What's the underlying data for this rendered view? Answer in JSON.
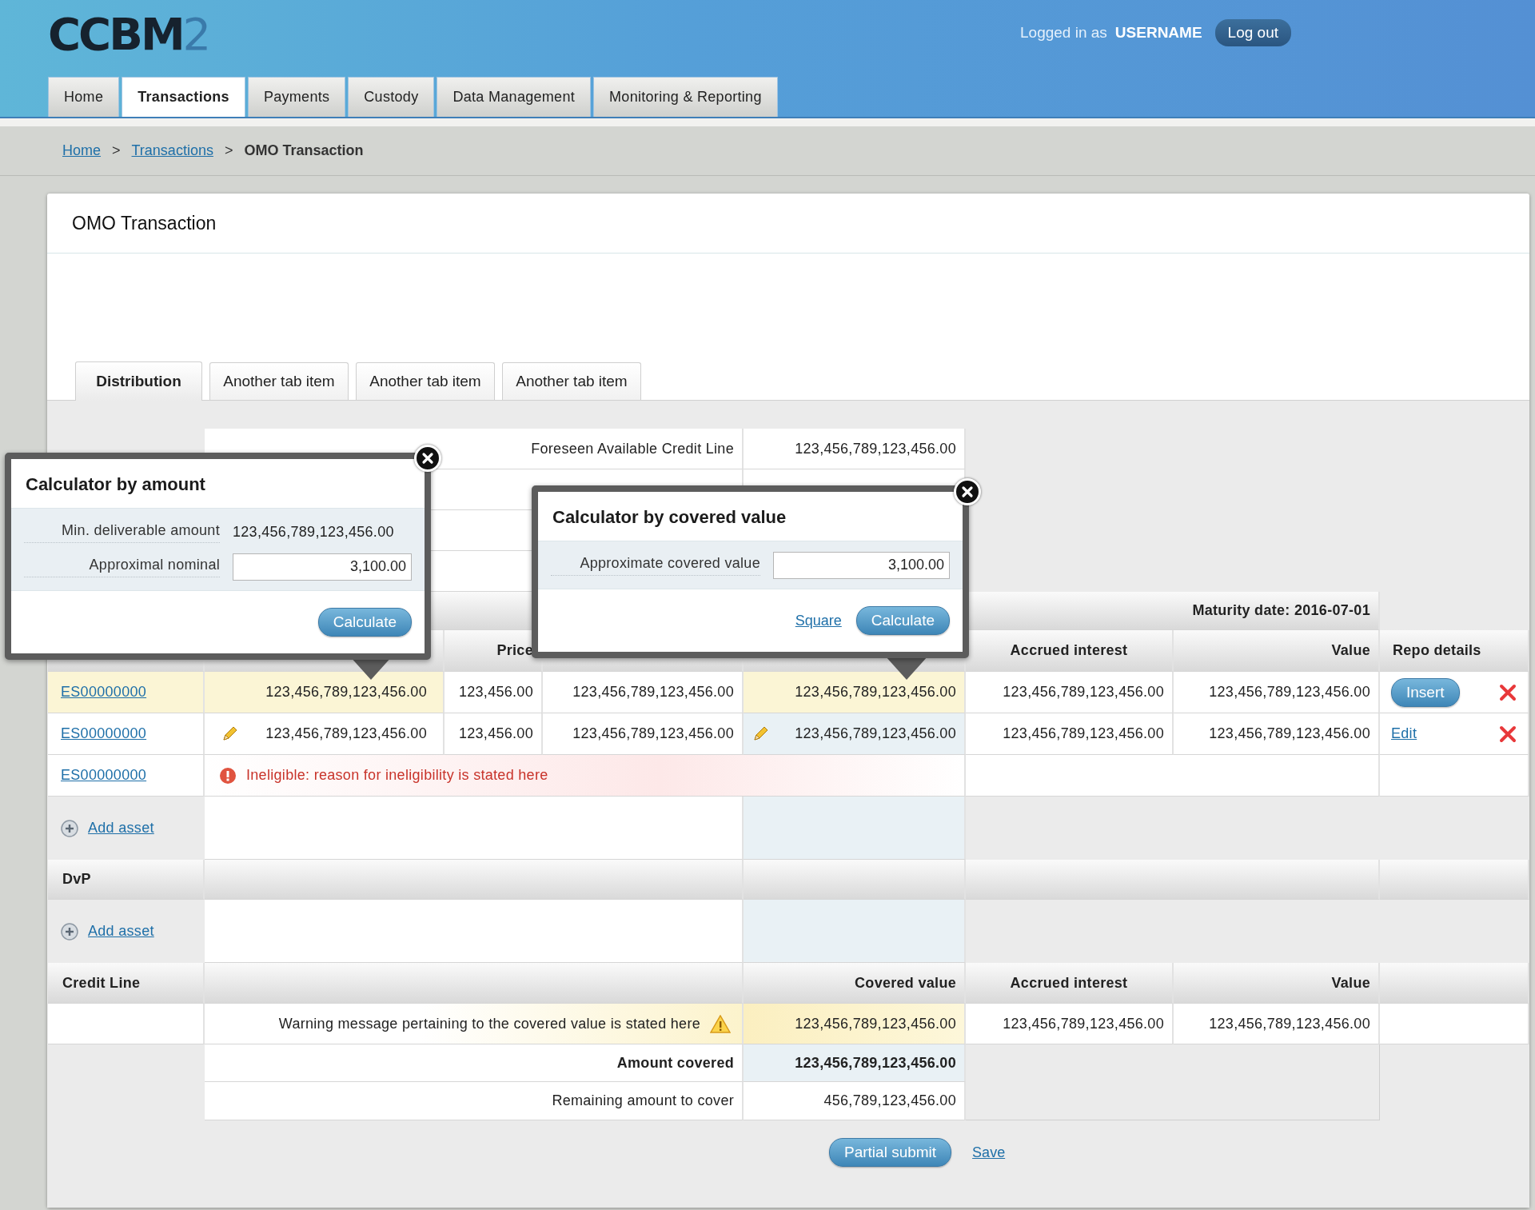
{
  "header": {
    "logo": "CCBM",
    "logo_suffix": "2",
    "logged_in_label": "Logged in as",
    "username": "USERNAME",
    "logout": "Log out"
  },
  "nav": [
    {
      "label": "Home",
      "selected": false
    },
    {
      "label": "Transactions",
      "selected": true
    },
    {
      "label": "Payments",
      "selected": false
    },
    {
      "label": "Custody",
      "selected": false
    },
    {
      "label": "Data Management",
      "selected": false
    },
    {
      "label": "Monitoring & Reporting",
      "selected": false
    }
  ],
  "breadcrumb": [
    {
      "kind": "link",
      "label": "Home"
    },
    {
      "kind": "separator",
      "label": ">"
    },
    {
      "kind": "link",
      "label": "Transactions"
    },
    {
      "kind": "separator",
      "label": ">"
    },
    {
      "kind": "current",
      "label": "OMO Transaction"
    }
  ],
  "page_title": "OMO Transaction",
  "tabs": [
    {
      "label": "Distribution",
      "selected": true
    },
    {
      "label": "Another tab item",
      "selected": false
    },
    {
      "label": "Another tab item",
      "selected": false
    },
    {
      "label": "Another tab item",
      "selected": false
    }
  ],
  "summary": [
    {
      "label": "Foreseen Available Credit Line",
      "value": "123,456,789,123,456.00"
    }
  ],
  "maturity": "Maturity date: 2016-07-01",
  "columns": {
    "price": "Price",
    "accrued_interest": "Accrued interest",
    "value": "Value",
    "repo_details": "Repo details"
  },
  "rows": [
    {
      "kind": "asset",
      "isin": "ES00000000",
      "highlighted": true,
      "editable": false,
      "nominal": "123,456,789,123,456.00",
      "price": "123,456.00",
      "collateral": "123,456,789,123,456.00",
      "covered": "123,456,789,123,456.00",
      "accrued": "123,456,789,123,456.00",
      "value": "123,456,789,123,456.00",
      "action": {
        "kind": "button",
        "label": "Insert"
      },
      "deletable": true
    },
    {
      "kind": "asset",
      "isin": "ES00000000",
      "highlighted": false,
      "editable": true,
      "nominal": "123,456,789,123,456.00",
      "price": "123,456.00",
      "collateral": "123,456,789,123,456.00",
      "covered": "123,456,789,123,456.00",
      "accrued": "123,456,789,123,456.00",
      "value": "123,456,789,123,456.00",
      "action": {
        "kind": "link",
        "label": "Edit"
      },
      "deletable": true
    },
    {
      "kind": "ineligible",
      "isin": "ES00000000",
      "message": "Ineligible: reason for ineligibility is stated here"
    }
  ],
  "sections": [
    {
      "kind": "add",
      "label": "Add asset"
    },
    {
      "kind": "heading",
      "label": "DvP"
    },
    {
      "kind": "add",
      "label": "Add asset"
    }
  ],
  "credit_line": {
    "label": "Credit Line",
    "columns": {
      "covered_value": "Covered value",
      "accrued_interest": "Accrued interest",
      "value": "Value"
    },
    "warning": "Warning message pertaining to the covered value is stated here",
    "covered": "123,456,789,123,456.00",
    "accrued": "123,456,789,123,456.00",
    "value": "123,456,789,123,456.00"
  },
  "totals": [
    {
      "label": "Amount covered",
      "value": "123,456,789,123,456.00",
      "emphasis": true
    },
    {
      "label": "Remaining amount to cover",
      "value": "456,789,123,456.00",
      "emphasis": false
    }
  ],
  "actions": [
    {
      "kind": "button",
      "label": "Partial submit"
    },
    {
      "kind": "link",
      "label": "Save"
    }
  ],
  "calculators": [
    {
      "title": "Calculator by amount",
      "fields": [
        {
          "kind": "text",
          "label": "Min. deliverable amount",
          "value": "123,456,789,123,456.00"
        },
        {
          "kind": "input",
          "label": "Approximal nominal",
          "value": "3,100.00"
        }
      ],
      "buttons": [
        {
          "kind": "button",
          "label": "Calculate"
        }
      ]
    },
    {
      "title": "Calculator by covered value",
      "fields": [
        {
          "kind": "input",
          "label": "Approximate covered value",
          "value": "3,100.00"
        }
      ],
      "buttons": [
        {
          "kind": "link",
          "label": "Square"
        },
        {
          "kind": "button",
          "label": "Calculate"
        }
      ]
    }
  ]
}
